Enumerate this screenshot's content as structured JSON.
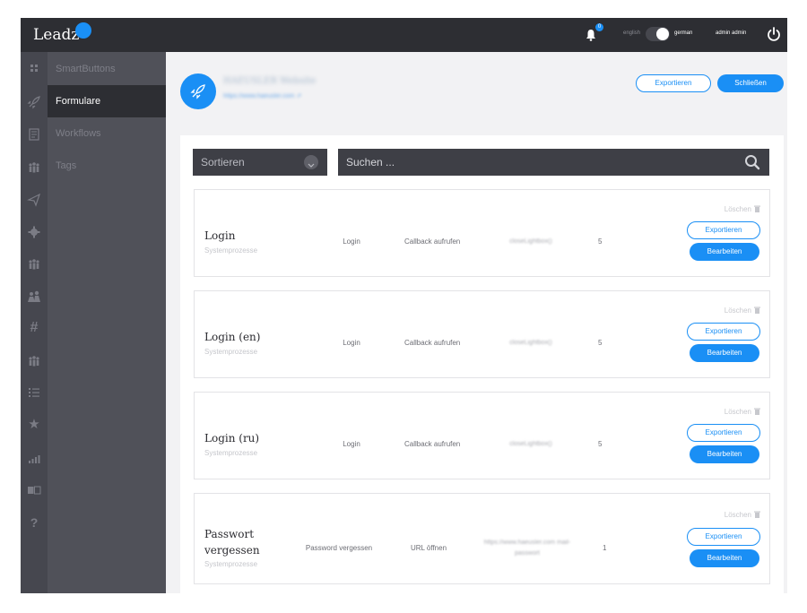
{
  "app": {
    "name": "Leadz"
  },
  "topbar": {
    "notifications_count": "0",
    "lang_en": "english",
    "lang_de": "german",
    "user": "admin admin"
  },
  "iconbar": {
    "icons": [
      "grid-icon",
      "rocket-icon",
      "form-icon",
      "people-icon",
      "send-icon",
      "gear-icon",
      "team-icon",
      "map-people-icon",
      "hash-icon",
      "group-icon",
      "list-icon",
      "star-icon",
      "signal-icon",
      "translate-icon",
      "help-icon"
    ]
  },
  "subnav": {
    "items": [
      {
        "label": "SmartButtons",
        "active": false
      },
      {
        "label": "Formulare",
        "active": true
      },
      {
        "label": "Workflows",
        "active": false
      },
      {
        "label": "Tags",
        "active": false
      }
    ]
  },
  "project": {
    "name": "HAEUSLER Website",
    "url": "https://www.haeusler.com ⇗"
  },
  "header_buttons": {
    "export": "Exportieren",
    "close": "Schließen"
  },
  "toolbar": {
    "sort_label": "Sortieren",
    "search_placeholder": "Suchen ..."
  },
  "cards": [
    {
      "title": "Login",
      "subtitle": "Systemprozesse",
      "type": "Login",
      "action": "Callback aufrufen",
      "target": "closeLightbox()",
      "count": "5",
      "delete": "Löschen",
      "export": "Exportieren",
      "edit": "Bearbeiten"
    },
    {
      "title": "Login (en)",
      "subtitle": "Systemprozesse",
      "type": "Login",
      "action": "Callback aufrufen",
      "target": "closeLightbox()",
      "count": "5",
      "delete": "Löschen",
      "export": "Exportieren",
      "edit": "Bearbeiten"
    },
    {
      "title": "Login (ru)",
      "subtitle": "Systemprozesse",
      "type": "Login",
      "action": "Callback aufrufen",
      "target": "closeLightbox()",
      "count": "5",
      "delete": "Löschen",
      "export": "Exportieren",
      "edit": "Bearbeiten"
    },
    {
      "title": "Passwort vergessen",
      "subtitle": "Systemprozesse",
      "type": "Password vergessen",
      "action": "URL öffnen",
      "target": "https://www.haeusler.com mail-passwort",
      "count": "1",
      "delete": "Löschen",
      "export": "Exportieren",
      "edit": "Bearbeiten"
    }
  ],
  "colors": {
    "accent": "#1a8ff5",
    "topbar": "#2d2e33",
    "sidebar": "#46474f",
    "subnav": "#505159"
  }
}
